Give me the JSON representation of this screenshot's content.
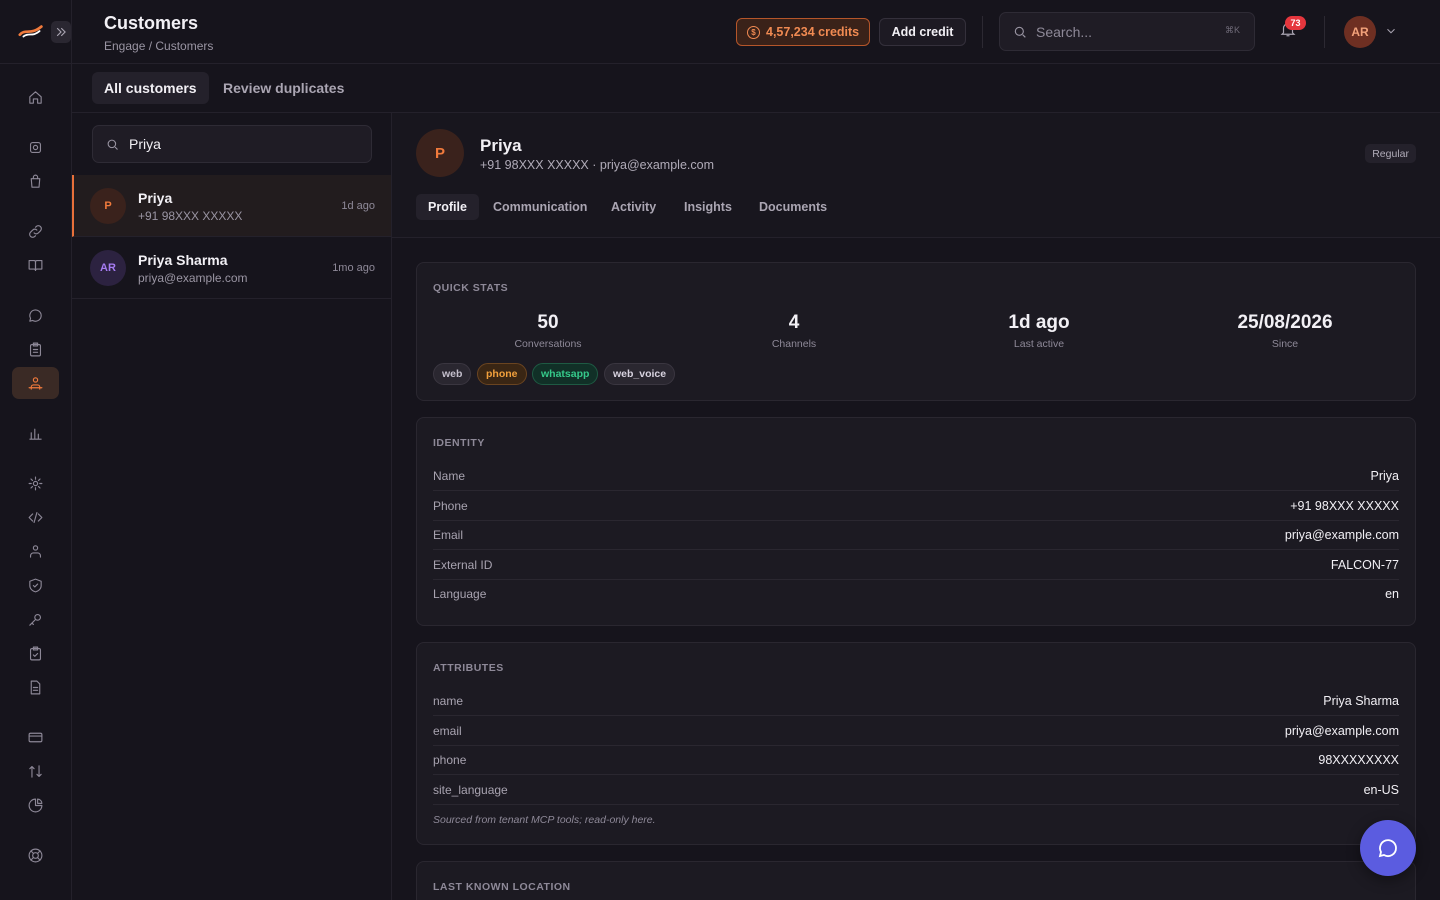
{
  "header": {
    "title": "Customers",
    "breadcrumb": "Engage / Customers",
    "credits": "4,57,234 credits",
    "add_credit": "Add credit",
    "search_placeholder": "Search...",
    "search_shortcut": "⌘K",
    "notifications_count": "73",
    "user_initials": "AR"
  },
  "subtabs": [
    "All customers",
    "Review duplicates"
  ],
  "list": {
    "search_value": "Priya",
    "items": [
      {
        "initials": "P",
        "name": "Priya",
        "sub": "+91 98XXX XXXXX",
        "time": "1d ago"
      },
      {
        "initials": "AR",
        "name": "Priya Sharma",
        "sub": "priya@example.com",
        "time": "1mo ago"
      }
    ]
  },
  "detail": {
    "initials": "P",
    "name": "Priya",
    "subtitle": "+91 98XXX XXXXX · priya@example.com",
    "segment": "Regular",
    "tabs": [
      "Profile",
      "Communication",
      "Activity",
      "Insights",
      "Documents"
    ],
    "quick_stats": {
      "title": "QUICK STATS",
      "stats": [
        {
          "value": "50",
          "label": "Conversations"
        },
        {
          "value": "4",
          "label": "Channels"
        },
        {
          "value": "1d ago",
          "label": "Last active"
        },
        {
          "value": "25/08/2026",
          "label": "Since"
        }
      ],
      "channels": [
        "web",
        "phone",
        "whatsapp",
        "web_voice"
      ]
    },
    "identity": {
      "title": "IDENTITY",
      "rows": [
        {
          "key": "Name",
          "value": "Priya"
        },
        {
          "key": "Phone",
          "value": "+91 98XXX XXXXX"
        },
        {
          "key": "Email",
          "value": "priya@example.com"
        },
        {
          "key": "External ID",
          "value": "FALCON-77"
        },
        {
          "key": "Language",
          "value": "en"
        }
      ]
    },
    "attributes": {
      "title": "ATTRIBUTES",
      "rows": [
        {
          "key": "name",
          "value": "Priya Sharma"
        },
        {
          "key": "email",
          "value": "priya@example.com"
        },
        {
          "key": "phone",
          "value": "98XXXXXXXX"
        },
        {
          "key": "site_language",
          "value": "en-US"
        }
      ],
      "note": "Sourced from tenant MCP tools; read-only here."
    },
    "location": {
      "title": "LAST KNOWN LOCATION"
    }
  },
  "colors": {
    "accent": "#f07a3c",
    "fab": "#5b5ce0",
    "badge": "#e5363d"
  }
}
